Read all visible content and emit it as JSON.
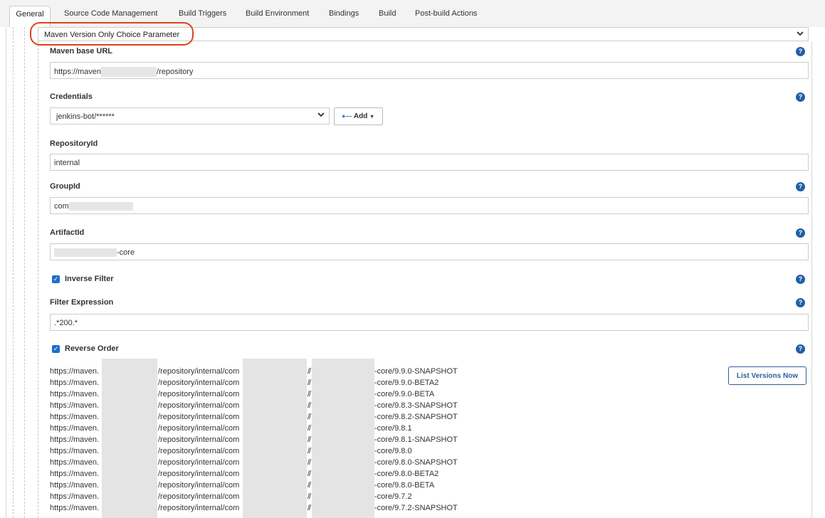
{
  "tabs": [
    {
      "label": "General",
      "active": true
    },
    {
      "label": "Source Code Management"
    },
    {
      "label": "Build Triggers"
    },
    {
      "label": "Build Environment"
    },
    {
      "label": "Bindings"
    },
    {
      "label": "Build"
    },
    {
      "label": "Post-build Actions"
    }
  ],
  "parameter_type": {
    "selected": "Maven Version Only Choice Parameter"
  },
  "fields": {
    "maven_base_url": {
      "label": "Maven base URL",
      "value_prefix": "https://maven",
      "value_suffix": "/repository"
    },
    "credentials": {
      "label": "Credentials",
      "selected": "jenkins-bot/******",
      "add_label": "Add"
    },
    "repository_id": {
      "label": "RepositoryId",
      "value": "internal"
    },
    "group_id": {
      "label": "GroupId",
      "value_prefix": "com"
    },
    "artifact_id": {
      "label": "ArtifactId",
      "value_suffix": "-core"
    },
    "inverse_filter": {
      "label": "Inverse Filter",
      "checked": true
    },
    "filter_expression": {
      "label": "Filter Expression",
      "value": ".*200.*"
    },
    "reverse_order": {
      "label": "Reverse Order",
      "checked": true
    }
  },
  "list_versions_button": "List Versions Now",
  "versions": {
    "prefix": "https://maven.",
    "mid": "/repository/internal/com",
    "sep": "/",
    "sep2": "/",
    "items": [
      "-core/9.9.0-SNAPSHOT",
      "-core/9.9.0-BETA2",
      "-core/9.9.0-BETA",
      "-core/9.8.3-SNAPSHOT",
      "-core/9.8.2-SNAPSHOT",
      "-core/9.8.1",
      "-core/9.8.1-SNAPSHOT",
      "-core/9.8.0",
      "-core/9.8.0-SNAPSHOT",
      "-core/9.8.0-BETA2",
      "-core/9.8.0-BETA",
      "-core/9.7.2",
      "-core/9.7.2-SNAPSHOT"
    ]
  },
  "colors": {
    "accent": "#1f5fa6",
    "highlight": "#e0411e"
  }
}
